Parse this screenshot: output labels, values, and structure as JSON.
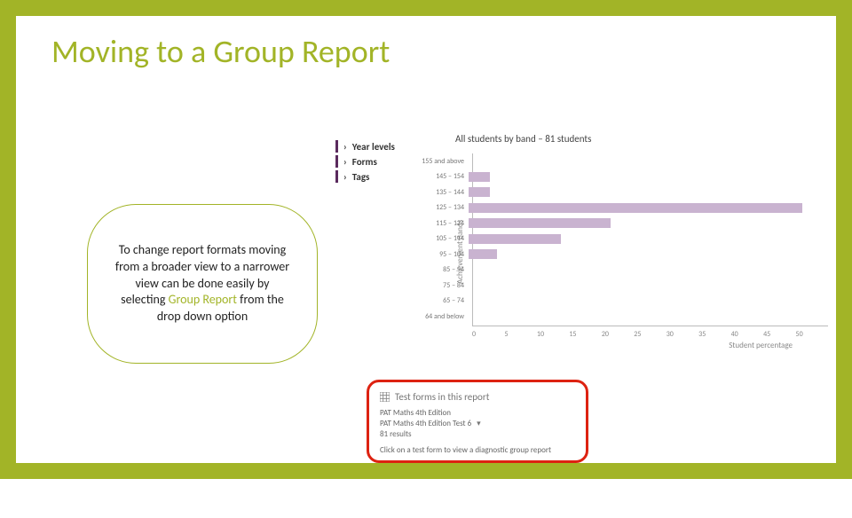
{
  "title": "Moving to a Group Report",
  "filters": [
    "Year levels",
    "Forms",
    "Tags"
  ],
  "callout": {
    "pre": "To change report formats moving from a broader view to a narrower view can be done easily by selecting ",
    "highlight": "Group Report",
    "post": " from the drop down option"
  },
  "chart_data": {
    "type": "bar",
    "title": "All students by band – 81 students",
    "ylabel": "Achievement Bands",
    "xlabel": "Student percentage",
    "categories": [
      "155 and above",
      "145 – 154",
      "135 – 144",
      "125 – 134",
      "115 – 124",
      "105 – 114",
      "95 – 104",
      "85 – 94",
      "75 – 84",
      "65 – 74",
      "64 and below"
    ],
    "values": [
      0,
      3,
      3,
      47,
      20,
      13,
      4,
      0,
      0,
      0,
      0
    ],
    "xlim": [
      0,
      50
    ],
    "xticks": [
      0,
      5,
      10,
      15,
      20,
      25,
      30,
      35,
      40,
      45,
      50
    ]
  },
  "redbox": {
    "title": "Test forms in this report",
    "family": "PAT Maths 4th Edition",
    "selected": "PAT Maths 4th Edition Test 6",
    "results": "81 results",
    "hint": "Click on a test form to view a diagnostic group report"
  }
}
